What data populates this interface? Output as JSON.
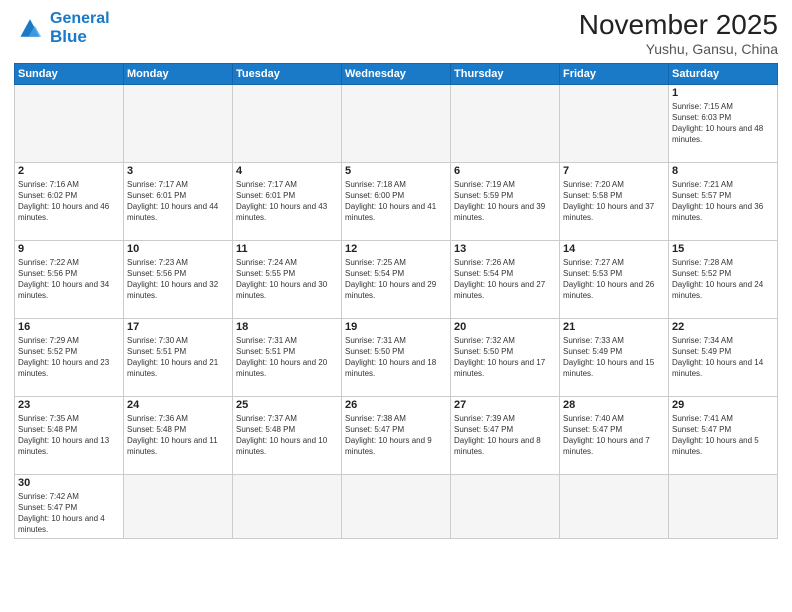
{
  "logo": {
    "text_general": "General",
    "text_blue": "Blue"
  },
  "header": {
    "month": "November 2025",
    "location": "Yushu, Gansu, China"
  },
  "days_of_week": [
    "Sunday",
    "Monday",
    "Tuesday",
    "Wednesday",
    "Thursday",
    "Friday",
    "Saturday"
  ],
  "weeks": [
    [
      {
        "day": "",
        "info": ""
      },
      {
        "day": "",
        "info": ""
      },
      {
        "day": "",
        "info": ""
      },
      {
        "day": "",
        "info": ""
      },
      {
        "day": "",
        "info": ""
      },
      {
        "day": "",
        "info": ""
      },
      {
        "day": "1",
        "info": "Sunrise: 7:15 AM\nSunset: 6:03 PM\nDaylight: 10 hours and 48 minutes."
      }
    ],
    [
      {
        "day": "2",
        "info": "Sunrise: 7:16 AM\nSunset: 6:02 PM\nDaylight: 10 hours and 46 minutes."
      },
      {
        "day": "3",
        "info": "Sunrise: 7:17 AM\nSunset: 6:01 PM\nDaylight: 10 hours and 44 minutes."
      },
      {
        "day": "4",
        "info": "Sunrise: 7:17 AM\nSunset: 6:01 PM\nDaylight: 10 hours and 43 minutes."
      },
      {
        "day": "5",
        "info": "Sunrise: 7:18 AM\nSunset: 6:00 PM\nDaylight: 10 hours and 41 minutes."
      },
      {
        "day": "6",
        "info": "Sunrise: 7:19 AM\nSunset: 5:59 PM\nDaylight: 10 hours and 39 minutes."
      },
      {
        "day": "7",
        "info": "Sunrise: 7:20 AM\nSunset: 5:58 PM\nDaylight: 10 hours and 37 minutes."
      },
      {
        "day": "8",
        "info": "Sunrise: 7:21 AM\nSunset: 5:57 PM\nDaylight: 10 hours and 36 minutes."
      }
    ],
    [
      {
        "day": "9",
        "info": "Sunrise: 7:22 AM\nSunset: 5:56 PM\nDaylight: 10 hours and 34 minutes."
      },
      {
        "day": "10",
        "info": "Sunrise: 7:23 AM\nSunset: 5:56 PM\nDaylight: 10 hours and 32 minutes."
      },
      {
        "day": "11",
        "info": "Sunrise: 7:24 AM\nSunset: 5:55 PM\nDaylight: 10 hours and 30 minutes."
      },
      {
        "day": "12",
        "info": "Sunrise: 7:25 AM\nSunset: 5:54 PM\nDaylight: 10 hours and 29 minutes."
      },
      {
        "day": "13",
        "info": "Sunrise: 7:26 AM\nSunset: 5:54 PM\nDaylight: 10 hours and 27 minutes."
      },
      {
        "day": "14",
        "info": "Sunrise: 7:27 AM\nSunset: 5:53 PM\nDaylight: 10 hours and 26 minutes."
      },
      {
        "day": "15",
        "info": "Sunrise: 7:28 AM\nSunset: 5:52 PM\nDaylight: 10 hours and 24 minutes."
      }
    ],
    [
      {
        "day": "16",
        "info": "Sunrise: 7:29 AM\nSunset: 5:52 PM\nDaylight: 10 hours and 23 minutes."
      },
      {
        "day": "17",
        "info": "Sunrise: 7:30 AM\nSunset: 5:51 PM\nDaylight: 10 hours and 21 minutes."
      },
      {
        "day": "18",
        "info": "Sunrise: 7:31 AM\nSunset: 5:51 PM\nDaylight: 10 hours and 20 minutes."
      },
      {
        "day": "19",
        "info": "Sunrise: 7:31 AM\nSunset: 5:50 PM\nDaylight: 10 hours and 18 minutes."
      },
      {
        "day": "20",
        "info": "Sunrise: 7:32 AM\nSunset: 5:50 PM\nDaylight: 10 hours and 17 minutes."
      },
      {
        "day": "21",
        "info": "Sunrise: 7:33 AM\nSunset: 5:49 PM\nDaylight: 10 hours and 15 minutes."
      },
      {
        "day": "22",
        "info": "Sunrise: 7:34 AM\nSunset: 5:49 PM\nDaylight: 10 hours and 14 minutes."
      }
    ],
    [
      {
        "day": "23",
        "info": "Sunrise: 7:35 AM\nSunset: 5:48 PM\nDaylight: 10 hours and 13 minutes."
      },
      {
        "day": "24",
        "info": "Sunrise: 7:36 AM\nSunset: 5:48 PM\nDaylight: 10 hours and 11 minutes."
      },
      {
        "day": "25",
        "info": "Sunrise: 7:37 AM\nSunset: 5:48 PM\nDaylight: 10 hours and 10 minutes."
      },
      {
        "day": "26",
        "info": "Sunrise: 7:38 AM\nSunset: 5:47 PM\nDaylight: 10 hours and 9 minutes."
      },
      {
        "day": "27",
        "info": "Sunrise: 7:39 AM\nSunset: 5:47 PM\nDaylight: 10 hours and 8 minutes."
      },
      {
        "day": "28",
        "info": "Sunrise: 7:40 AM\nSunset: 5:47 PM\nDaylight: 10 hours and 7 minutes."
      },
      {
        "day": "29",
        "info": "Sunrise: 7:41 AM\nSunset: 5:47 PM\nDaylight: 10 hours and 5 minutes."
      }
    ],
    [
      {
        "day": "30",
        "info": "Sunrise: 7:42 AM\nSunset: 5:47 PM\nDaylight: 10 hours and 4 minutes."
      },
      {
        "day": "",
        "info": ""
      },
      {
        "day": "",
        "info": ""
      },
      {
        "day": "",
        "info": ""
      },
      {
        "day": "",
        "info": ""
      },
      {
        "day": "",
        "info": ""
      },
      {
        "day": "",
        "info": ""
      }
    ]
  ]
}
